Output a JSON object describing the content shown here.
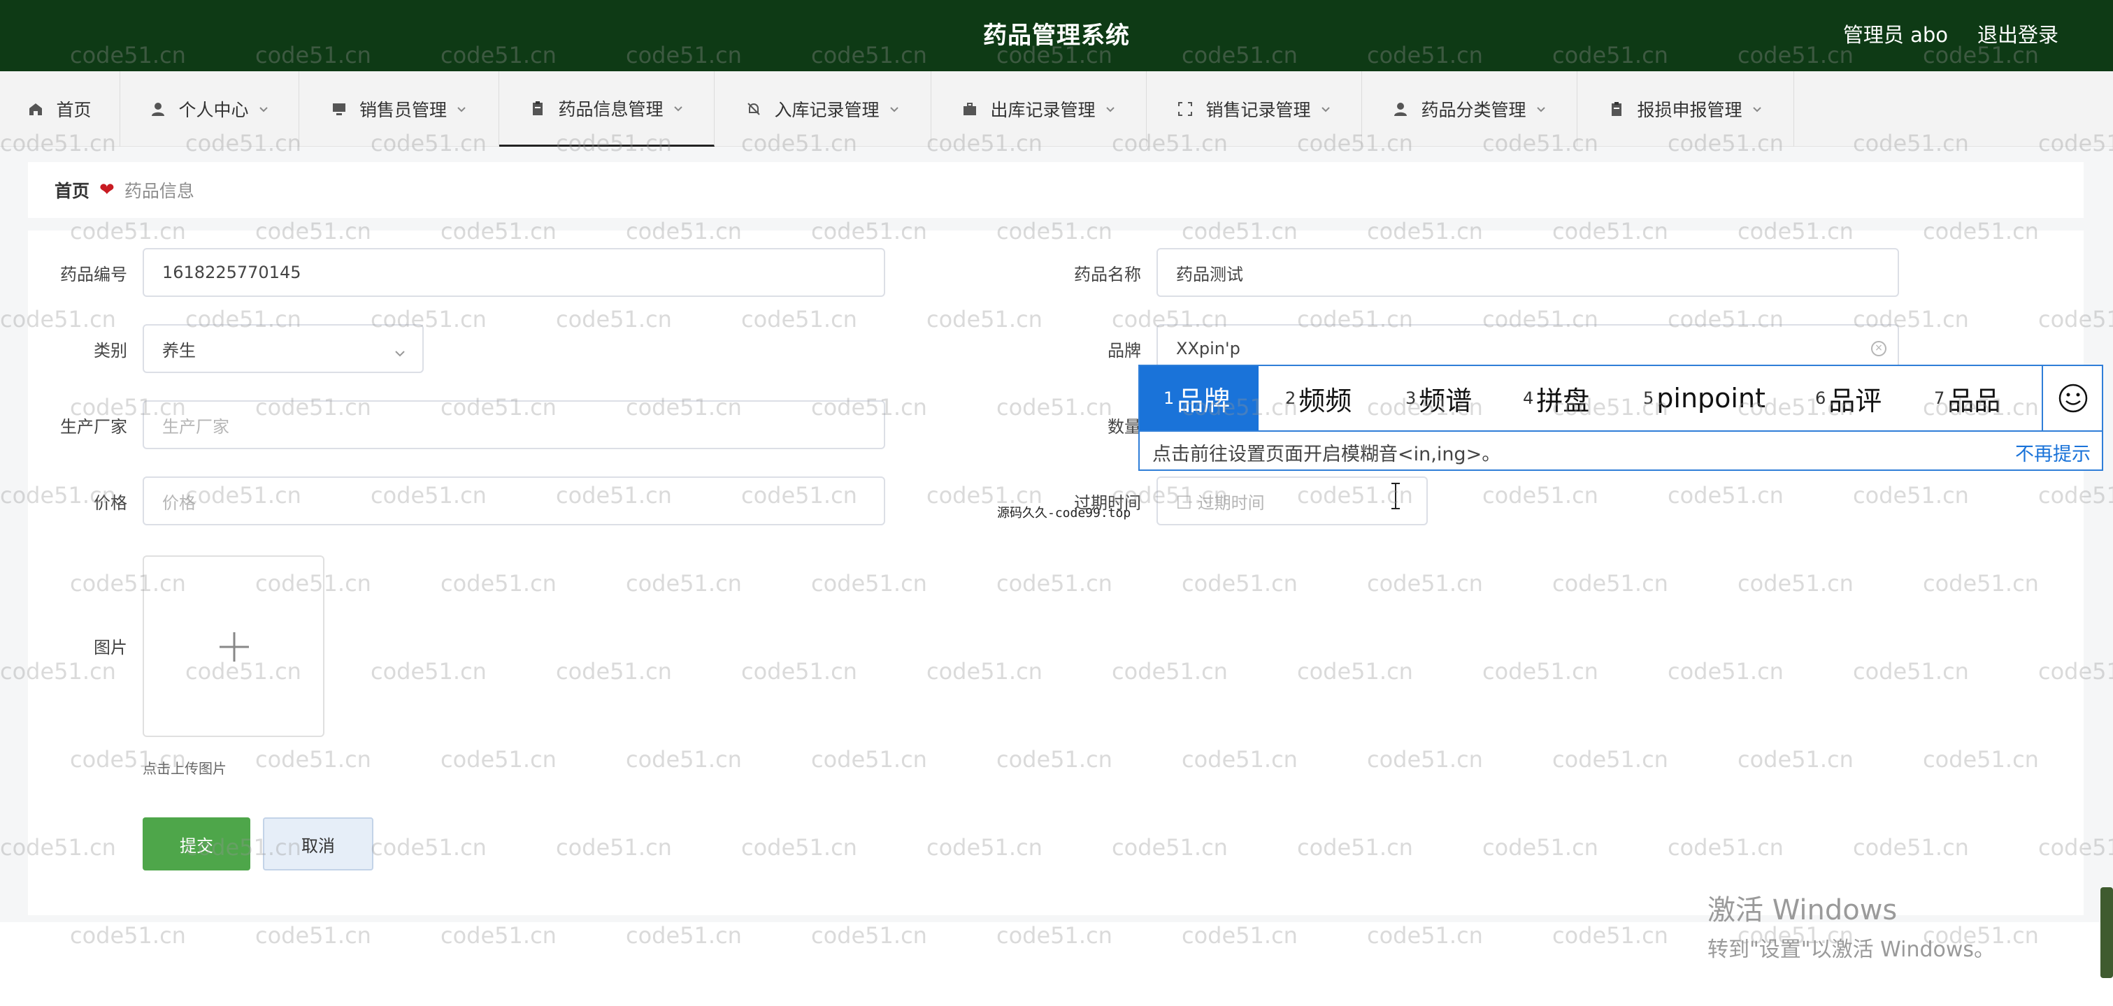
{
  "header": {
    "title": "药品管理系统",
    "user": "管理员 abo",
    "logout": "退出登录"
  },
  "nav": [
    {
      "label": "首页",
      "icon": "home-icon",
      "dropdown": false
    },
    {
      "label": "个人中心",
      "icon": "user-icon",
      "dropdown": true
    },
    {
      "label": "销售员管理",
      "icon": "monitor-icon",
      "dropdown": true
    },
    {
      "label": "药品信息管理",
      "icon": "clipboard-icon",
      "dropdown": true,
      "active": true
    },
    {
      "label": "入库记录管理",
      "icon": "bell-off-icon",
      "dropdown": true
    },
    {
      "label": "出库记录管理",
      "icon": "briefcase-icon",
      "dropdown": true
    },
    {
      "label": "销售记录管理",
      "icon": "scan-icon",
      "dropdown": true
    },
    {
      "label": "药品分类管理",
      "icon": "user-icon",
      "dropdown": true
    },
    {
      "label": "报损申报管理",
      "icon": "clipboard-icon",
      "dropdown": true
    }
  ],
  "breadcrumb": {
    "home": "首页",
    "current": "药品信息"
  },
  "form": {
    "code_label": "药品编号",
    "code_value": "1618225770145",
    "name_label": "药品名称",
    "name_value": "药品测试",
    "category_label": "类别",
    "category_value": "养生",
    "brand_label": "品牌",
    "brand_value": "XXpin'p",
    "maker_label": "生产厂家",
    "maker_placeholder": "生产厂家",
    "qty_label": "数量",
    "price_label": "价格",
    "price_placeholder": "价格",
    "expire_label": "过期时间",
    "expire_placeholder": "过期时间",
    "image_label": "图片",
    "upload_hint": "点击上传图片",
    "submit": "提交",
    "cancel": "取消"
  },
  "source_note": "源码久久-code99.top",
  "ime": {
    "candidates": [
      {
        "n": "1",
        "text": "品牌"
      },
      {
        "n": "2",
        "text": "频频"
      },
      {
        "n": "3",
        "text": "频谱"
      },
      {
        "n": "4",
        "text": "拼盘"
      },
      {
        "n": "5",
        "text": "pinpoint"
      },
      {
        "n": "6",
        "text": "品评"
      },
      {
        "n": "7",
        "text": "品品"
      }
    ],
    "hint": "点击前往设置页面开启模糊音<in,ing>。",
    "no_remind": "不再提示"
  },
  "windows": {
    "line1": "激活 Windows",
    "line2": "转到\"设置\"以激活 Windows。"
  },
  "watermark": "code51.cn",
  "colors": {
    "header_bg": "#0e3a15",
    "submit_bg": "#4ea64a",
    "ime_blue": "#1a73d9"
  }
}
